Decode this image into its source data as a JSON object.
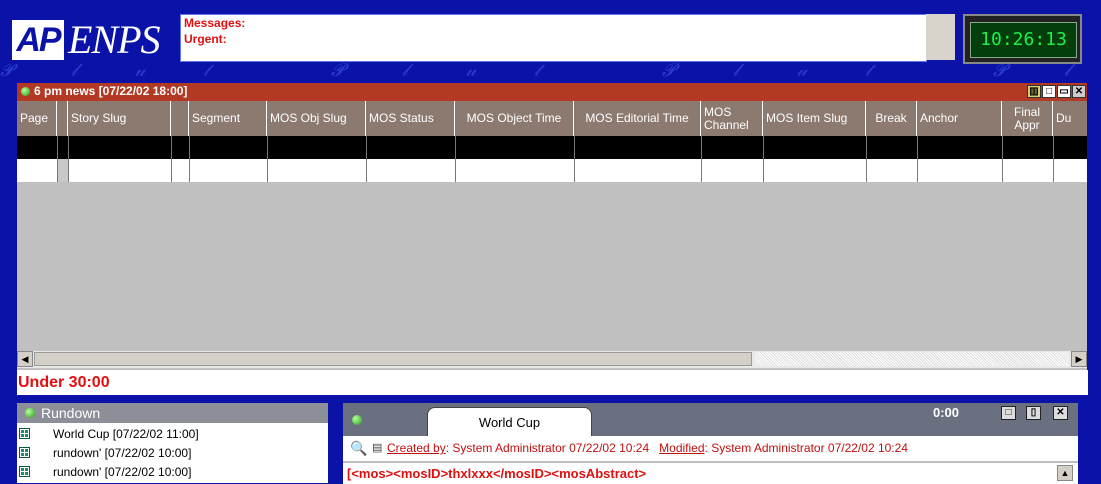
{
  "header": {
    "logo_ap": "AP",
    "logo_enps": "ENPS",
    "messages_label": "Messages:",
    "urgent_label": "Urgent:",
    "clock": "10:26:13"
  },
  "rundown_window": {
    "title": "6 pm news [07/22/02 18:00]",
    "columns": [
      "Page",
      "",
      "Story Slug",
      "",
      "Segment",
      "MOS Obj Slug",
      "MOS Status",
      "MOS Object Time",
      "MOS Editorial Time",
      "MOS Channel",
      "MOS Item Slug",
      "Break",
      "Anchor",
      "Final Appr",
      "Du"
    ],
    "status": "Under 30:00"
  },
  "rundown_list": {
    "title": "Rundown",
    "items": [
      "World Cup [07/22/02 11:00]",
      "rundown' [07/22/02 10:00]",
      "rundown' [07/22/02 10:00]"
    ]
  },
  "story": {
    "tab": "World Cup",
    "time": "0:00",
    "created_label": "Created by",
    "created_value": ": System Administrator  07/22/02 10:24",
    "modified_label": "Modified",
    "modified_value": ": System Administrator  07/22/02 10:24",
    "body": "[<mos><mosID>thxlxxx</mosID><mosAbstract>"
  },
  "colors": {
    "background": "#0a12a8",
    "title_bar": "#b23a25",
    "column_header": "#8c7a70",
    "alert_text": "#e01010",
    "clock_text": "#1df04a"
  }
}
